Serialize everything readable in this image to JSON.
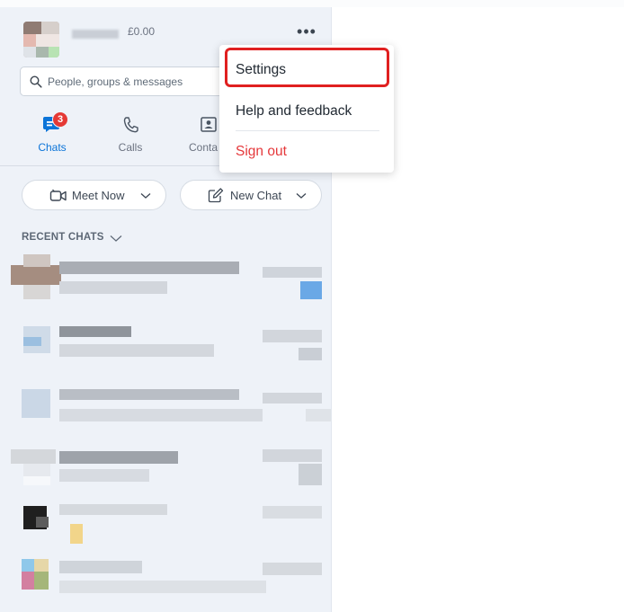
{
  "profile": {
    "credit": "£0.00",
    "more_label": "•••"
  },
  "search": {
    "placeholder": "People, groups & messages"
  },
  "nav": {
    "chats": "Chats",
    "calls": "Calls",
    "contacts": "Conta",
    "chats_badge": "3"
  },
  "actions": {
    "meet_now": "Meet Now",
    "new_chat": "New Chat"
  },
  "recent_header": "RECENT CHATS",
  "menu": {
    "settings": "Settings",
    "help": "Help and feedback",
    "sign_out": "Sign out",
    "sign_out_color": "#e5383b"
  },
  "colors": {
    "accent": "#0b74d8",
    "highlight_border": "#e02020"
  }
}
